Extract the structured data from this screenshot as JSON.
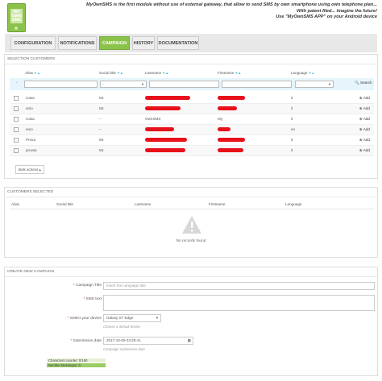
{
  "logo": {
    "text": "MY\nOWN\nSMS"
  },
  "header": {
    "lines": [
      "MyOwnSMS is the first module without use of external gateway, that allow to send SMS by own smartphone using own telephone plan...",
      "With patent filed... Imagine the future!",
      "Use \"MyOwnSMS APP\" on your Android device"
    ]
  },
  "tabs": [
    {
      "label": "CONFIGURATION",
      "active": false
    },
    {
      "label": "NOTIFICATIONS",
      "active": false
    },
    {
      "label": "CAMPAIGN",
      "active": true
    },
    {
      "label": "HISTORY",
      "active": false
    },
    {
      "label": "DOCUMENTATION",
      "active": false
    }
  ],
  "selection": {
    "title": "SELECTION CUSTOMERS",
    "columns": [
      "Alias",
      "Social title",
      "Lastname",
      "Firstname",
      "Language"
    ],
    "filter_select_placeholder": "-",
    "search_label": "Search",
    "rows": [
      {
        "alias": "Casa",
        "social_title": "Mr.",
        "lastname": "",
        "firstname": "",
        "language": "it",
        "redacted": true
      },
      {
        "alias": "enio",
        "social_title": "Mr.",
        "lastname": "",
        "firstname": "",
        "language": "it",
        "redacted": true
      },
      {
        "alias": "Casa",
        "social_title": "--",
        "lastname": "OwnSMS",
        "firstname": "My",
        "language": "it",
        "redacted": false
      },
      {
        "alias": "enio",
        "social_title": "--",
        "lastname": "",
        "firstname": "",
        "language": "en",
        "redacted": true
      },
      {
        "alias": "Prova",
        "social_title": "Mr.",
        "lastname": "",
        "firstname": "",
        "language": "it",
        "redacted": true
      },
      {
        "alias": "prova1",
        "social_title": "Mr.",
        "lastname": "",
        "firstname": "",
        "language": "it",
        "redacted": true
      }
    ],
    "add_label": "Add",
    "bulk_label": "Bulk actions"
  },
  "selected": {
    "title": "CUSTOMERS SELECTED",
    "columns": [
      "Alias",
      "Social title",
      "Lastname",
      "Firstname",
      "Language"
    ],
    "empty_text": "No records found"
  },
  "campaign": {
    "title": "CREATE NEW CAMPAIGN",
    "fields": {
      "campaign_title_label": "Campaign Title",
      "campaign_title_placeholder": "Insert the campaign title",
      "sms_text_label": "SMS text",
      "device_label": "Select your device",
      "device_value": "Galaxy S7 Edge",
      "device_hint": "Choose a default device",
      "date_label": "Submission date",
      "date_value": "2017-10-09 23:29:41",
      "date_hint": "Campaign submission date"
    },
    "counters": {
      "chars": "Characters counter: 0/160",
      "messages": "Number Messages: 0"
    }
  },
  "colors": {
    "accent": "#8bc34a",
    "link": "#2fb5d2",
    "redaction": "#e8101a"
  }
}
